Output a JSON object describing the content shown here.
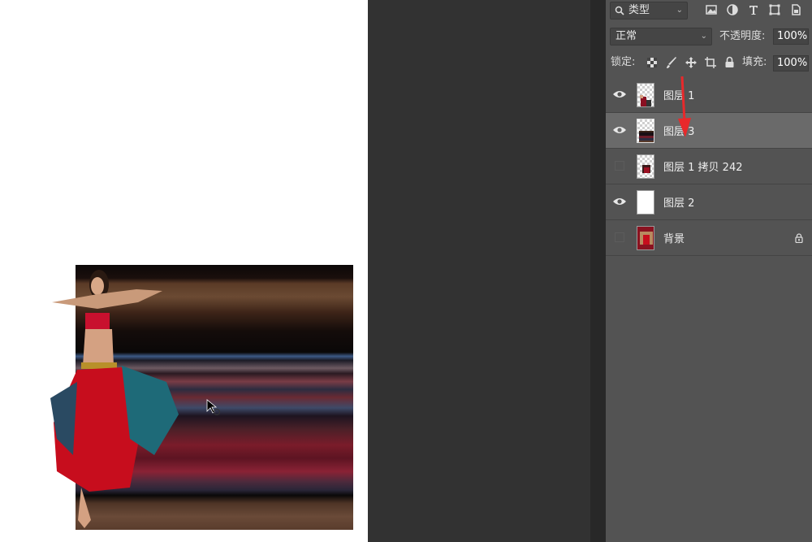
{
  "layers_panel": {
    "filter_kind": "类型",
    "blend_mode": "正常",
    "opacity_label": "不透明度:",
    "opacity_value": "100%",
    "lock_label": "锁定:",
    "fill_label": "填充:",
    "fill_value": "100%",
    "layers": [
      {
        "name": "图层 1",
        "visible": true,
        "selected": false
      },
      {
        "name": "图层 3",
        "visible": true,
        "selected": true
      },
      {
        "name": "图层 1 拷贝 242",
        "visible": false,
        "selected": false
      },
      {
        "name": "图层 2",
        "visible": true,
        "selected": false
      },
      {
        "name": "背景",
        "visible": false,
        "selected": false,
        "locked": true
      }
    ]
  },
  "colors": {
    "annotation_arrow": "#e8292b",
    "panel_bg": "#535353",
    "selected_layer_bg": "#6a6a6a",
    "pasteboard_bg": "#323232"
  },
  "icons": [
    "search-icon",
    "image-filter-icon",
    "adjustment-filter-icon",
    "type-filter-icon",
    "shape-filter-icon",
    "smart-object-filter-icon",
    "lock-transparent-icon",
    "lock-paint-icon",
    "lock-move-icon",
    "lock-artboard-icon",
    "lock-all-icon",
    "eye-icon",
    "lock-icon",
    "cursor-icon"
  ]
}
